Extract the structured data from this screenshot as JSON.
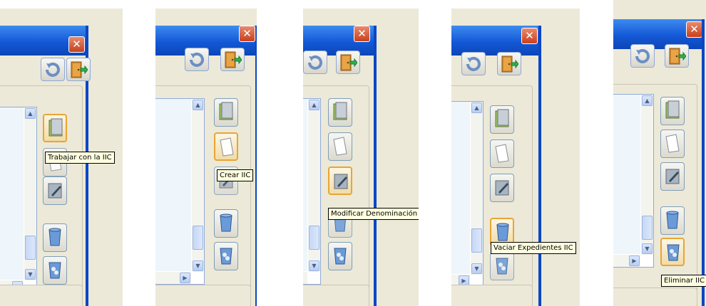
{
  "window": {
    "close_glyph": "✕"
  },
  "scroll_glyphs": {
    "up": "▲",
    "down": "▼",
    "right": "▶"
  },
  "frames": [
    {
      "tooltip": "Trabajar con la IIC",
      "highlighted_button": "trabajar-icon"
    },
    {
      "tooltip": "Crear IIC",
      "highlighted_button": "crear-icon"
    },
    {
      "tooltip": "Modificar Denominación",
      "highlighted_button": "modificar-icon"
    },
    {
      "tooltip": "Vaciar Expedientes IIC",
      "highlighted_button": "vaciar-icon"
    },
    {
      "tooltip": "Eliminar IIC",
      "highlighted_button": "eliminar-icon"
    }
  ],
  "buttons": [
    {
      "name": "refresh-icon"
    },
    {
      "name": "exit-door-icon"
    },
    {
      "name": "trabajar-icon"
    },
    {
      "name": "crear-icon"
    },
    {
      "name": "modificar-icon"
    },
    {
      "name": "vaciar-icon"
    },
    {
      "name": "eliminar-icon"
    }
  ],
  "colors": {
    "titlebar": "#1458d6",
    "window_bg": "#ece9d8",
    "hover_border": "#e8a536",
    "tooltip_bg": "#ffffe1",
    "close": "#d5532f"
  }
}
